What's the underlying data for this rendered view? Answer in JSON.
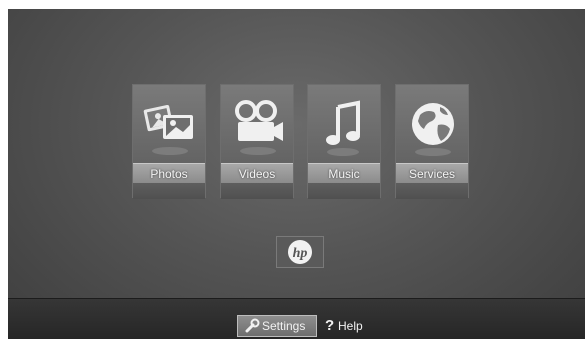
{
  "menu": {
    "tiles": [
      {
        "label": "Photos",
        "icon": "photos-icon"
      },
      {
        "label": "Videos",
        "icon": "video-camera-icon"
      },
      {
        "label": "Music",
        "icon": "music-note-icon"
      },
      {
        "label": "Services",
        "icon": "globe-icon"
      }
    ]
  },
  "brand": {
    "logo": "hp",
    "icon": "hp-logo-icon"
  },
  "bottombar": {
    "settings_label": "Settings",
    "settings_icon": "wrench-icon",
    "help_label": "Help",
    "help_icon": "question-mark-icon"
  },
  "colors": {
    "background": "#555555",
    "tile": "#6a6a6a",
    "label_bar": "#999999",
    "text": "#f4f4f4"
  }
}
